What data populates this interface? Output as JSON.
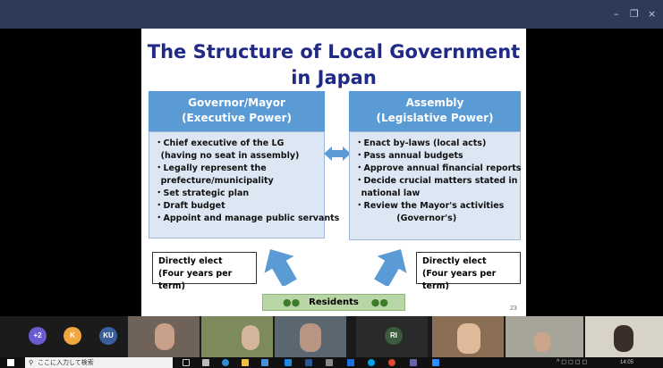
{
  "window": {
    "minimize_glyph": "–",
    "restore_glyph": "❐",
    "close_glyph": "×"
  },
  "slide": {
    "title_line1": "The Structure of Local Government",
    "title_line2": "in Japan",
    "left_box": {
      "heading1": "Governor/Mayor",
      "heading2": "(Executive Power)",
      "bullets": [
        "・Chief executive of the LG",
        "  (having no seat in assembly)",
        "・Legally represent the",
        "  prefecture/municipality",
        "・Set strategic plan",
        "・Draft budget",
        "・Appoint and manage public servants"
      ]
    },
    "right_box": {
      "heading1": "Assembly",
      "heading2": "(Legislative Power)",
      "bullets": [
        "・Enact by-laws (local acts)",
        "・Pass annual budgets",
        "・Approve annual financial reports",
        "・Decide crucial matters stated in",
        "  national law",
        "・Review the Mayor's activities",
        "              (Governor's)"
      ]
    },
    "left_elect": {
      "line1": "Directly elect",
      "line2": "(Four years per term)"
    },
    "right_elect": {
      "line1": "Directly elect",
      "line2": "(Four years per term)"
    },
    "residents_label": "Residents",
    "page_number": "23"
  },
  "participants": {
    "extra_count": "+2",
    "avatars": [
      {
        "initial": "K",
        "color": "#f2a640"
      },
      {
        "initial": "KU",
        "color": "#3a5f9a"
      }
    ],
    "video_tile_avatar": "RI"
  },
  "taskbar": {
    "search_placeholder": "ここに入力して検索",
    "clock_time": "14:05"
  },
  "colors": {
    "title": "#1f2a86",
    "box_header": "#5b9bd5",
    "box_body": "#dde6f3",
    "arrow": "#5b9bd5",
    "residents_bg": "#b9d7a6",
    "titlebar": "#2e3a5a"
  }
}
